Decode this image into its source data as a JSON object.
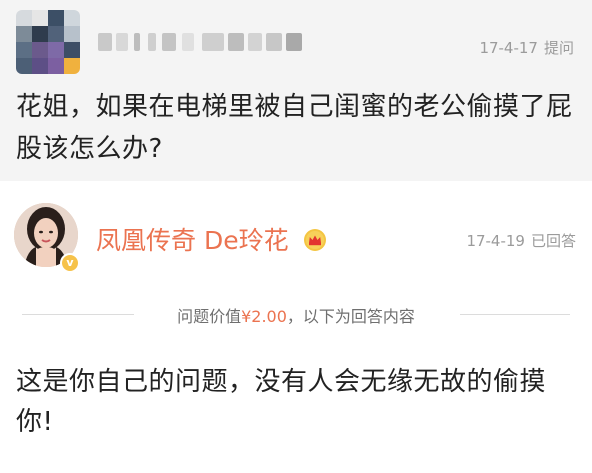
{
  "question": {
    "meta_date": "17-4-17",
    "meta_action": "提问",
    "text": "花姐，如果在电梯里被自己闺蜜的老公偷摸了屁股该怎么办?"
  },
  "answer": {
    "author_name": "凤凰传奇 De玲花",
    "meta_date": "17-4-19",
    "meta_action": "已回答",
    "badge": "v",
    "divider_prefix": "问题价值",
    "divider_price": "¥2.00",
    "divider_suffix": "，以下为回答内容",
    "text": "这是你自己的问题，没有人会无缘无故的偷摸你!"
  },
  "colors": {
    "accent": "#eb7350",
    "meta": "#9b9b9b",
    "question_bg": "#f4f4f4"
  }
}
